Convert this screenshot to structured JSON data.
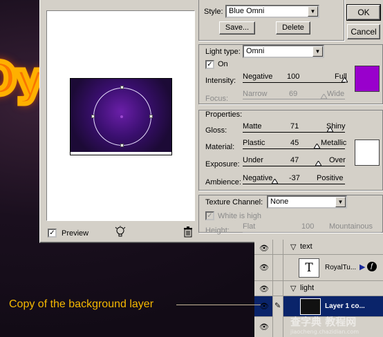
{
  "background": {
    "glow_text": "Oy",
    "glow_color": "#ffb000"
  },
  "dialog": {
    "style_label": "Style:",
    "style_value": "Blue Omni",
    "save_button": "Save...",
    "delete_button": "Delete",
    "ok_button": "OK",
    "cancel_button": "Cancel",
    "light_type_label": "Light type:",
    "light_type_value": "Omni",
    "on_label": "On",
    "on_checked": true,
    "intensity": {
      "label": "Intensity:",
      "left": "Negative",
      "value": "100",
      "right": "Full",
      "color": "#9900cc"
    },
    "focus": {
      "label": "Focus:",
      "left": "Narrow",
      "value": "69",
      "right": "Wide"
    },
    "properties_label": "Properties:",
    "gloss": {
      "label": "Gloss:",
      "left": "Matte",
      "value": "71",
      "right": "Shiny"
    },
    "material": {
      "label": "Material:",
      "left": "Plastic",
      "value": "45",
      "right": "Metallic"
    },
    "exposure": {
      "label": "Exposure:",
      "left": "Under",
      "value": "47",
      "right": "Over"
    },
    "ambience": {
      "label": "Ambience:",
      "left": "Negative",
      "value": "-37",
      "right": "Positive"
    },
    "properties_color": "#ffffff",
    "texture_channel_label": "Texture Channel:",
    "texture_channel_value": "None",
    "white_is_high_label": "White is high",
    "height": {
      "label": "Height:",
      "left": "Flat",
      "value": "100",
      "right": "Mountainous"
    },
    "preview_label": "Preview",
    "preview_checked": true,
    "light_bulb_icon": "light-bulb-icon",
    "trash_icon": "trash-icon"
  },
  "layers": {
    "rows": [
      {
        "name": "text",
        "type": "folder"
      },
      {
        "name": "RoyalTu...",
        "type": "text-layer",
        "thumb": "T"
      },
      {
        "name": "light",
        "type": "folder"
      },
      {
        "name": "Layer 1 co...",
        "type": "layer",
        "selected": true
      }
    ]
  },
  "annotation": "Copy of the background layer",
  "watermark": {
    "line1": "查字典 教程网",
    "line2": "jiaocheng.chazidian.com"
  }
}
